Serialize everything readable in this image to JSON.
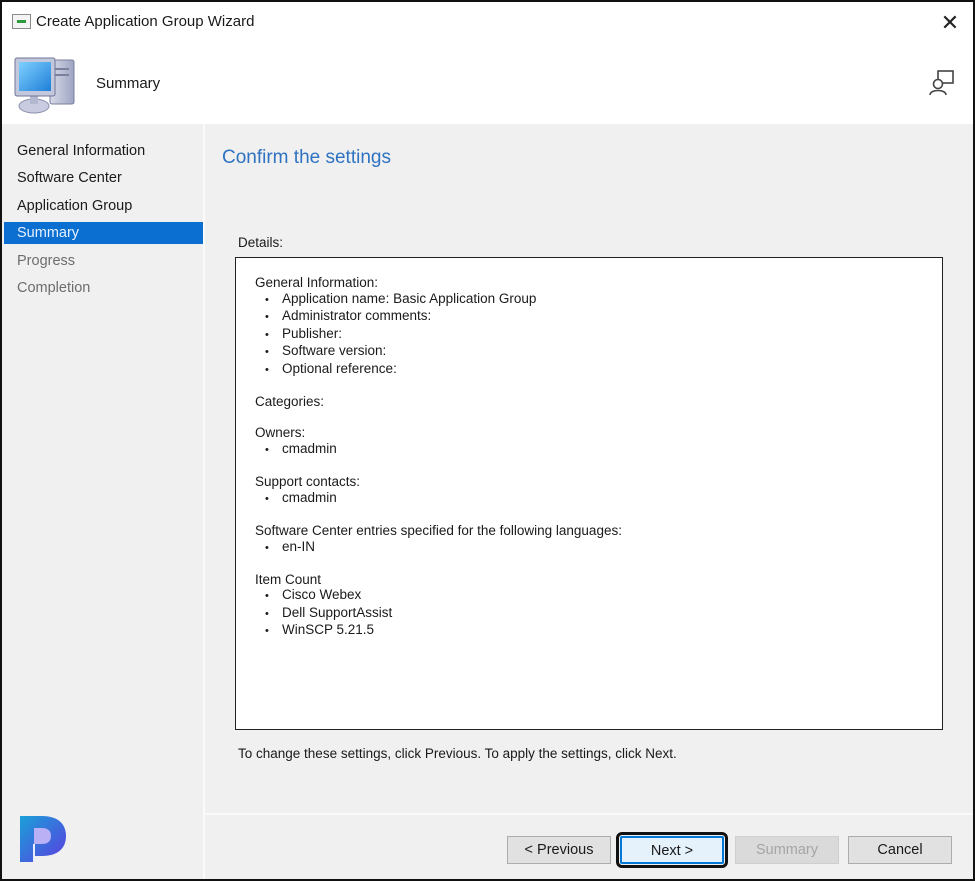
{
  "window": {
    "title": "Create Application Group Wizard",
    "icons": {
      "app": "wizard-window-icon",
      "close": "close-icon"
    },
    "close_glyph": "✕"
  },
  "header": {
    "title": "Summary",
    "icons": {
      "banner": "computer-icon",
      "feedback": "feedback-icon"
    }
  },
  "sidebar": {
    "items": [
      {
        "label": "General Information",
        "state": "normal"
      },
      {
        "label": "Software Center",
        "state": "normal"
      },
      {
        "label": "Application Group",
        "state": "normal"
      },
      {
        "label": "Summary",
        "state": "active"
      },
      {
        "label": "Progress",
        "state": "disabled"
      },
      {
        "label": "Completion",
        "state": "disabled"
      }
    ],
    "logo": "prajwal-logo-icon"
  },
  "main": {
    "heading": "Confirm the settings",
    "heading_color": "#2e72c2",
    "details_label": "Details:",
    "details": {
      "sections": [
        {
          "title": "General Information:",
          "items": [
            "Application name: Basic Application Group",
            "Administrator comments:",
            "Publisher:",
            "Software version:",
            "Optional reference:"
          ]
        },
        {
          "title": "Categories:",
          "items": []
        },
        {
          "title": "Owners:",
          "items": [
            "cmadmin"
          ]
        },
        {
          "title": "Support contacts:",
          "items": [
            "cmadmin"
          ]
        },
        {
          "title": "Software Center entries specified for the following languages:",
          "items": [
            "en-IN"
          ]
        },
        {
          "title": "Item Count",
          "items": [
            "Cisco Webex",
            "Dell SupportAssist",
            "WinSCP 5.21.5"
          ]
        }
      ]
    },
    "hint": "To change these settings, click Previous. To apply the settings, click Next."
  },
  "buttons": {
    "previous": "< Previous",
    "next": "Next >",
    "summary": "Summary",
    "cancel": "Cancel"
  },
  "colors": {
    "accent": "#0a6fd1",
    "sidebar_bg": "#f0f0f0"
  }
}
